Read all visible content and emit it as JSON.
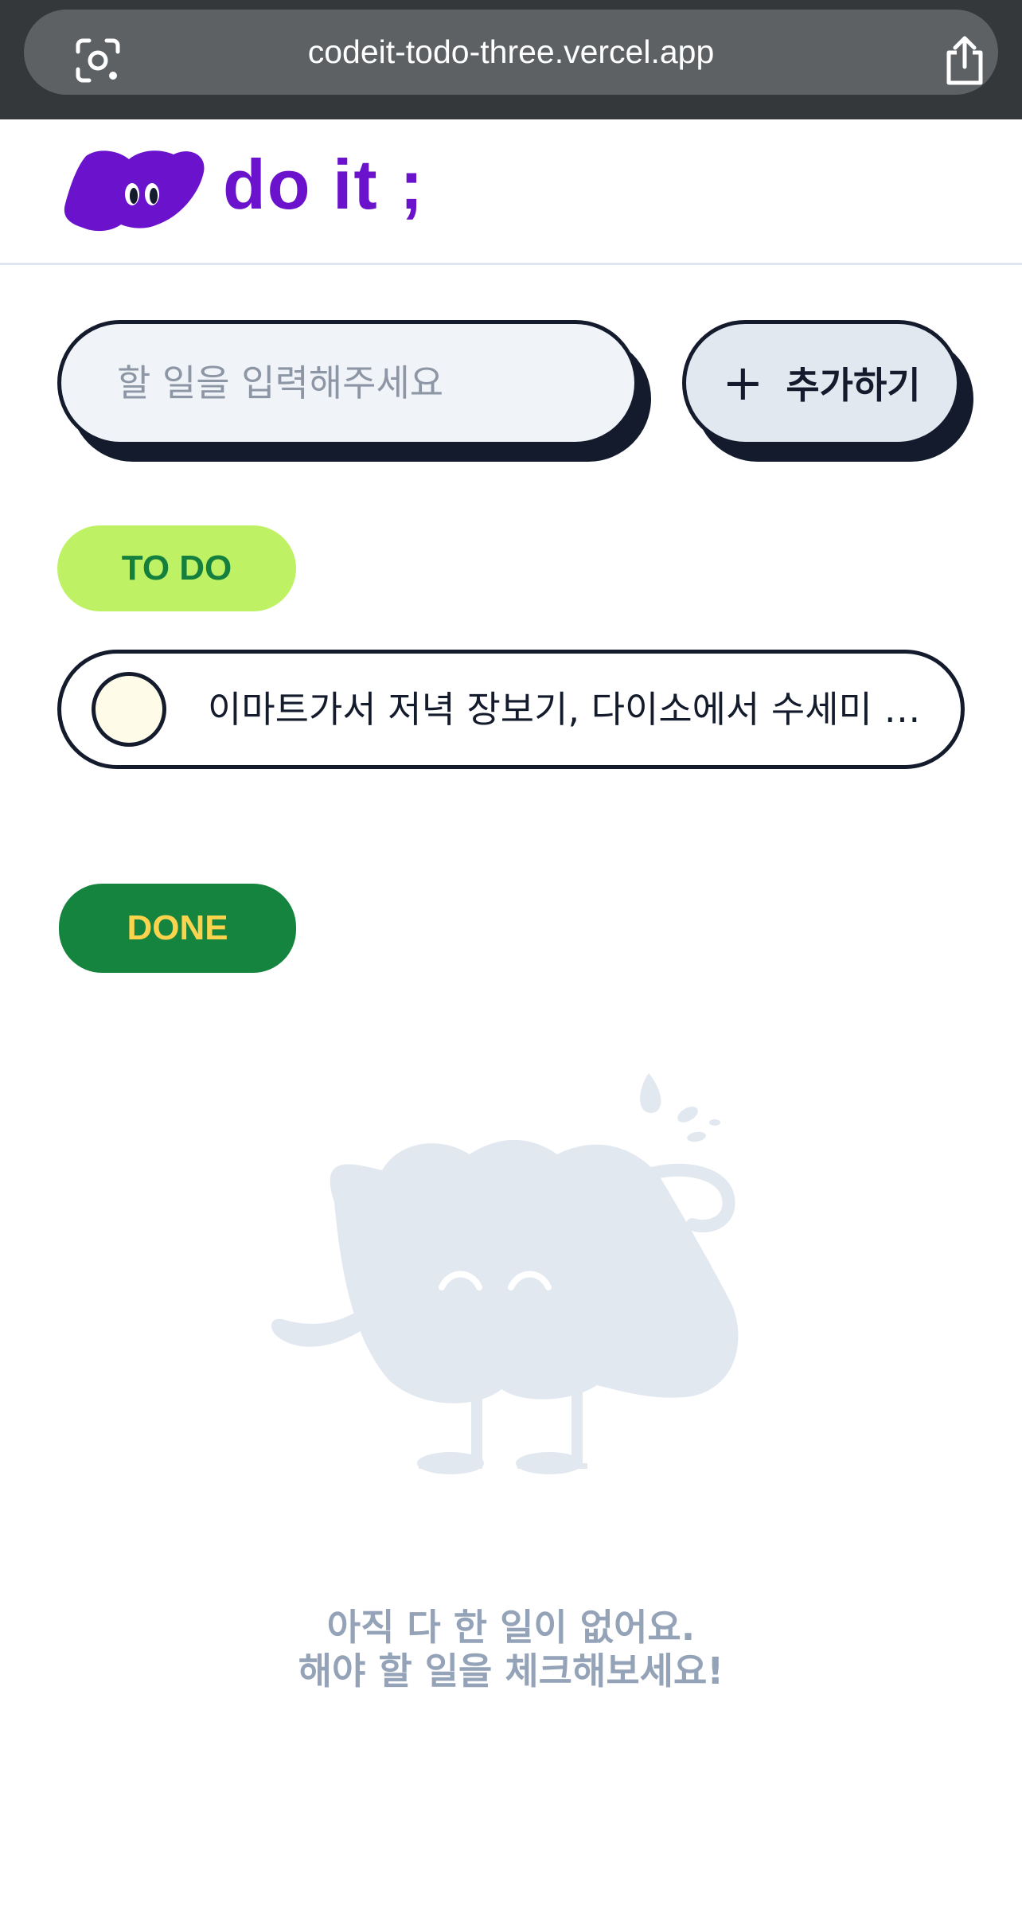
{
  "browser": {
    "url": "codeit-todo-three.vercel.app",
    "left_icon": "lens-icon",
    "right_icon": "share-icon"
  },
  "header": {
    "logo_text": "do it ;",
    "logo_icon": "blob-mascot-logo",
    "brand_color": "#6b12cc"
  },
  "add_form": {
    "placeholder": "할 일을 입력해주세요",
    "value": "",
    "button_label": "추가하기",
    "button_icon": "plus-icon"
  },
  "todo_section": {
    "badge_label": "TO DO",
    "items": [
      {
        "text": "이마트가서 저녁 장보기, 다이소에서 수세미 사기",
        "done": false
      }
    ]
  },
  "done_section": {
    "badge_label": "DONE",
    "items": [],
    "empty_illustration": "empty-mascot-illustration",
    "empty_message_line1": "아직 다 한 일이 없어요.",
    "empty_message_line2": "해야 할 일을 체크해보세요!"
  },
  "colors": {
    "outline": "#131b2c",
    "todo_badge_bg": "#bef264",
    "todo_badge_text": "#15803d",
    "done_badge_bg": "#15843f",
    "done_badge_text": "#fcd34d",
    "illustration": "#e2e8f0",
    "empty_text": "#94a3b8"
  }
}
